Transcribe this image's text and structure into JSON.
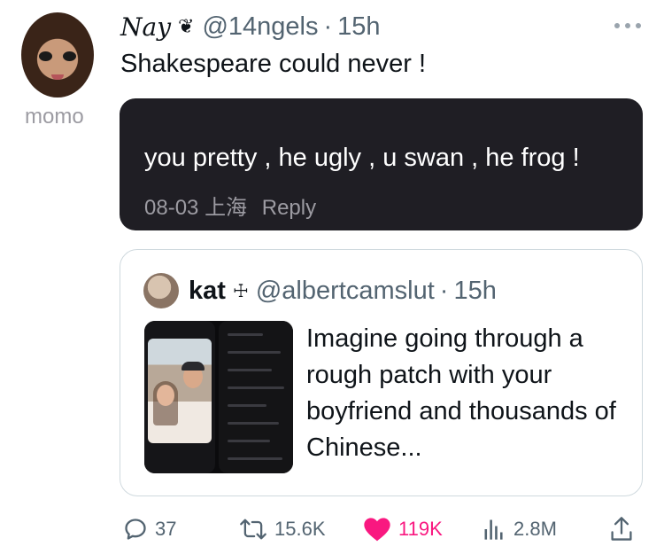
{
  "tweet": {
    "display_name": "Nay",
    "name_badge": "❦",
    "handle": "@14ngels",
    "separator": "·",
    "time": "15h",
    "text": "Shakespeare could never !"
  },
  "screenshot_comment": {
    "username": "momo",
    "comment": "you pretty , he ugly , u swan , he frog !",
    "date": "08-03",
    "location": "上海",
    "reply_label": "Reply"
  },
  "quoted_tweet": {
    "display_name": "kat",
    "name_badge": "☩",
    "handle": "@albertcamslut",
    "separator": "·",
    "time": "15h",
    "text": "Imagine going through a rough patch with your boyfriend and thousands of Chinese..."
  },
  "actions": {
    "replies": "37",
    "retweets": "15.6K",
    "likes": "119K",
    "views": "2.8M"
  },
  "icons": {
    "reply": "speech-bubble-icon",
    "retweet": "retweet-icon",
    "like": "heart-icon",
    "views": "bar-chart-icon",
    "share": "share-icon",
    "more": "more-dots-icon"
  },
  "colors": {
    "like_active": "#f91880",
    "secondary_text": "#536471",
    "dark_card": "#1f1e24"
  }
}
